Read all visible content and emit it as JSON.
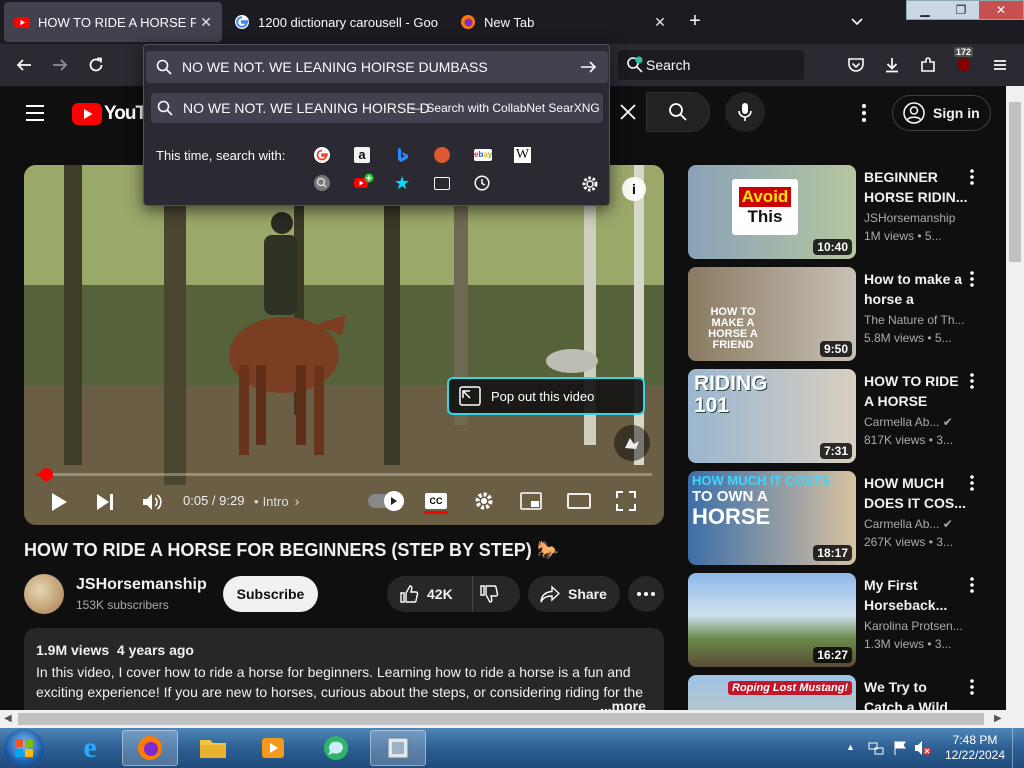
{
  "browser": {
    "tabs": [
      {
        "label": "HOW TO RIDE A HORSE FOR BE",
        "active": true,
        "favicon": "youtube-icon"
      },
      {
        "label": "1200 dictionary carousell - Goo",
        "active": false,
        "favicon": "google-icon"
      },
      {
        "label": "New Tab",
        "active": false,
        "favicon": "firefox-icon"
      }
    ],
    "url_input_value": "NO WE NOT. WE LEANING HOIRSE DUMBASS",
    "search_box_placeholder": "Search",
    "extension_badge": "172",
    "suggestion": {
      "query": "NO WE NOT. WE LEANING HOIRSE D",
      "engine_hint": "— Search with CollabNet SearXNG"
    },
    "search_with_label": "This time, search with:",
    "search_engines": [
      "google-icon",
      "amazon-icon",
      "bing-icon",
      "duckduckgo-icon",
      "ebay-icon",
      "wikipedia-icon",
      "searx-icon",
      "youtube-plus-icon",
      "bookmarks-icon",
      "tabs-icon",
      "history-icon"
    ]
  },
  "youtube": {
    "header": {
      "logo_text": "YouTu",
      "sign_in": "Sign in"
    },
    "video": {
      "time": "0:05 / 9:29",
      "chapter": "Intro",
      "popout_label": "Pop out this video",
      "progress": 0.009
    },
    "title": "HOW TO RIDE A HORSE FOR BEGINNERS (STEP BY STEP) 🐎",
    "channel": {
      "name": "JSHorsemanship",
      "subscribers": "153K subscribers"
    },
    "subscribe_label": "Subscribe",
    "likes": "42K",
    "share_label": "Share",
    "description": {
      "stats": "1.9M views  4 years ago",
      "text": "In this video, I cover how to ride a horse for beginners. Learning how to ride a horse is a fun and exciting experience! If you are new to horses, curious about the steps, or considering riding for the first time this should help get you started. I start the video with a couple safety tips and the",
      "more": "...more"
    },
    "recommendations": [
      {
        "title": "BEGINNER HORSE RIDIN...",
        "channel": "JSHorsemanship",
        "views": "1M views • 5...",
        "duration": "10:40",
        "thumb_text": "Avoid This",
        "verified": false
      },
      {
        "title": "How to make a horse a friend...",
        "channel": "The Nature of Th...",
        "views": "5.8M views • 5...",
        "duration": "9:50",
        "thumb_text": "HOW TO MAKE A HORSE A FRIEND",
        "verified": false
      },
      {
        "title": "HOW TO RIDE A HORSE (EASY...",
        "channel": "Carmella Ab...",
        "views": "817K views • 3...",
        "duration": "7:31",
        "thumb_text": "RIDING 101",
        "verified": true
      },
      {
        "title": "HOW MUCH DOES IT COS...",
        "channel": "Carmella Ab...",
        "views": "267K views • 3...",
        "duration": "18:17",
        "thumb_text": "HOW MUCH IT COSTS TO OWN A HORSE",
        "verified": true
      },
      {
        "title": "My First Horseback...",
        "channel": "Karolina Protsen...",
        "views": "1.3M views • 3...",
        "duration": "16:27",
        "thumb_text": "",
        "verified": false
      },
      {
        "title": "We Try to Catch a Wild...",
        "channel": "",
        "views": "",
        "duration": "",
        "thumb_text": "Roping Lost Mustang!",
        "verified": false
      }
    ]
  },
  "taskbar": {
    "apps": [
      "start-orb",
      "internet-explorer-icon",
      "firefox-icon",
      "file-explorer-icon",
      "media-player-icon",
      "chat-app-icon",
      "window-app-icon"
    ],
    "time": "7:48 PM",
    "date": "12/22/2024"
  }
}
